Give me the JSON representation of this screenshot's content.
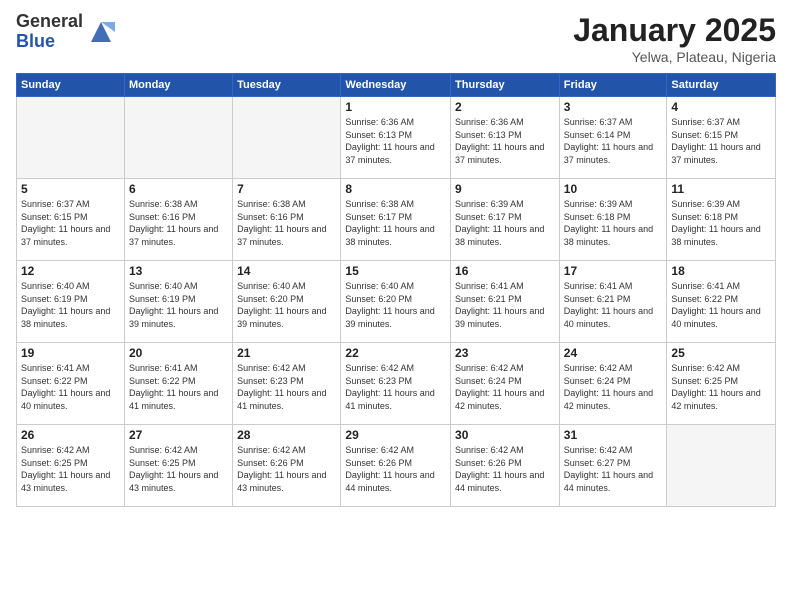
{
  "logo": {
    "general": "General",
    "blue": "Blue"
  },
  "header": {
    "month": "January 2025",
    "location": "Yelwa, Plateau, Nigeria"
  },
  "days_of_week": [
    "Sunday",
    "Monday",
    "Tuesday",
    "Wednesday",
    "Thursday",
    "Friday",
    "Saturday"
  ],
  "weeks": [
    [
      {
        "day": "",
        "info": ""
      },
      {
        "day": "",
        "info": ""
      },
      {
        "day": "",
        "info": ""
      },
      {
        "day": "1",
        "info": "Sunrise: 6:36 AM\nSunset: 6:13 PM\nDaylight: 11 hours\nand 37 minutes."
      },
      {
        "day": "2",
        "info": "Sunrise: 6:36 AM\nSunset: 6:13 PM\nDaylight: 11 hours\nand 37 minutes."
      },
      {
        "day": "3",
        "info": "Sunrise: 6:37 AM\nSunset: 6:14 PM\nDaylight: 11 hours\nand 37 minutes."
      },
      {
        "day": "4",
        "info": "Sunrise: 6:37 AM\nSunset: 6:15 PM\nDaylight: 11 hours\nand 37 minutes."
      }
    ],
    [
      {
        "day": "5",
        "info": "Sunrise: 6:37 AM\nSunset: 6:15 PM\nDaylight: 11 hours\nand 37 minutes."
      },
      {
        "day": "6",
        "info": "Sunrise: 6:38 AM\nSunset: 6:16 PM\nDaylight: 11 hours\nand 37 minutes."
      },
      {
        "day": "7",
        "info": "Sunrise: 6:38 AM\nSunset: 6:16 PM\nDaylight: 11 hours\nand 37 minutes."
      },
      {
        "day": "8",
        "info": "Sunrise: 6:38 AM\nSunset: 6:17 PM\nDaylight: 11 hours\nand 38 minutes."
      },
      {
        "day": "9",
        "info": "Sunrise: 6:39 AM\nSunset: 6:17 PM\nDaylight: 11 hours\nand 38 minutes."
      },
      {
        "day": "10",
        "info": "Sunrise: 6:39 AM\nSunset: 6:18 PM\nDaylight: 11 hours\nand 38 minutes."
      },
      {
        "day": "11",
        "info": "Sunrise: 6:39 AM\nSunset: 6:18 PM\nDaylight: 11 hours\nand 38 minutes."
      }
    ],
    [
      {
        "day": "12",
        "info": "Sunrise: 6:40 AM\nSunset: 6:19 PM\nDaylight: 11 hours\nand 38 minutes."
      },
      {
        "day": "13",
        "info": "Sunrise: 6:40 AM\nSunset: 6:19 PM\nDaylight: 11 hours\nand 39 minutes."
      },
      {
        "day": "14",
        "info": "Sunrise: 6:40 AM\nSunset: 6:20 PM\nDaylight: 11 hours\nand 39 minutes."
      },
      {
        "day": "15",
        "info": "Sunrise: 6:40 AM\nSunset: 6:20 PM\nDaylight: 11 hours\nand 39 minutes."
      },
      {
        "day": "16",
        "info": "Sunrise: 6:41 AM\nSunset: 6:21 PM\nDaylight: 11 hours\nand 39 minutes."
      },
      {
        "day": "17",
        "info": "Sunrise: 6:41 AM\nSunset: 6:21 PM\nDaylight: 11 hours\nand 40 minutes."
      },
      {
        "day": "18",
        "info": "Sunrise: 6:41 AM\nSunset: 6:22 PM\nDaylight: 11 hours\nand 40 minutes."
      }
    ],
    [
      {
        "day": "19",
        "info": "Sunrise: 6:41 AM\nSunset: 6:22 PM\nDaylight: 11 hours\nand 40 minutes."
      },
      {
        "day": "20",
        "info": "Sunrise: 6:41 AM\nSunset: 6:22 PM\nDaylight: 11 hours\nand 41 minutes."
      },
      {
        "day": "21",
        "info": "Sunrise: 6:42 AM\nSunset: 6:23 PM\nDaylight: 11 hours\nand 41 minutes."
      },
      {
        "day": "22",
        "info": "Sunrise: 6:42 AM\nSunset: 6:23 PM\nDaylight: 11 hours\nand 41 minutes."
      },
      {
        "day": "23",
        "info": "Sunrise: 6:42 AM\nSunset: 6:24 PM\nDaylight: 11 hours\nand 42 minutes."
      },
      {
        "day": "24",
        "info": "Sunrise: 6:42 AM\nSunset: 6:24 PM\nDaylight: 11 hours\nand 42 minutes."
      },
      {
        "day": "25",
        "info": "Sunrise: 6:42 AM\nSunset: 6:25 PM\nDaylight: 11 hours\nand 42 minutes."
      }
    ],
    [
      {
        "day": "26",
        "info": "Sunrise: 6:42 AM\nSunset: 6:25 PM\nDaylight: 11 hours\nand 43 minutes."
      },
      {
        "day": "27",
        "info": "Sunrise: 6:42 AM\nSunset: 6:25 PM\nDaylight: 11 hours\nand 43 minutes."
      },
      {
        "day": "28",
        "info": "Sunrise: 6:42 AM\nSunset: 6:26 PM\nDaylight: 11 hours\nand 43 minutes."
      },
      {
        "day": "29",
        "info": "Sunrise: 6:42 AM\nSunset: 6:26 PM\nDaylight: 11 hours\nand 44 minutes."
      },
      {
        "day": "30",
        "info": "Sunrise: 6:42 AM\nSunset: 6:26 PM\nDaylight: 11 hours\nand 44 minutes."
      },
      {
        "day": "31",
        "info": "Sunrise: 6:42 AM\nSunset: 6:27 PM\nDaylight: 11 hours\nand 44 minutes."
      },
      {
        "day": "",
        "info": ""
      }
    ]
  ]
}
